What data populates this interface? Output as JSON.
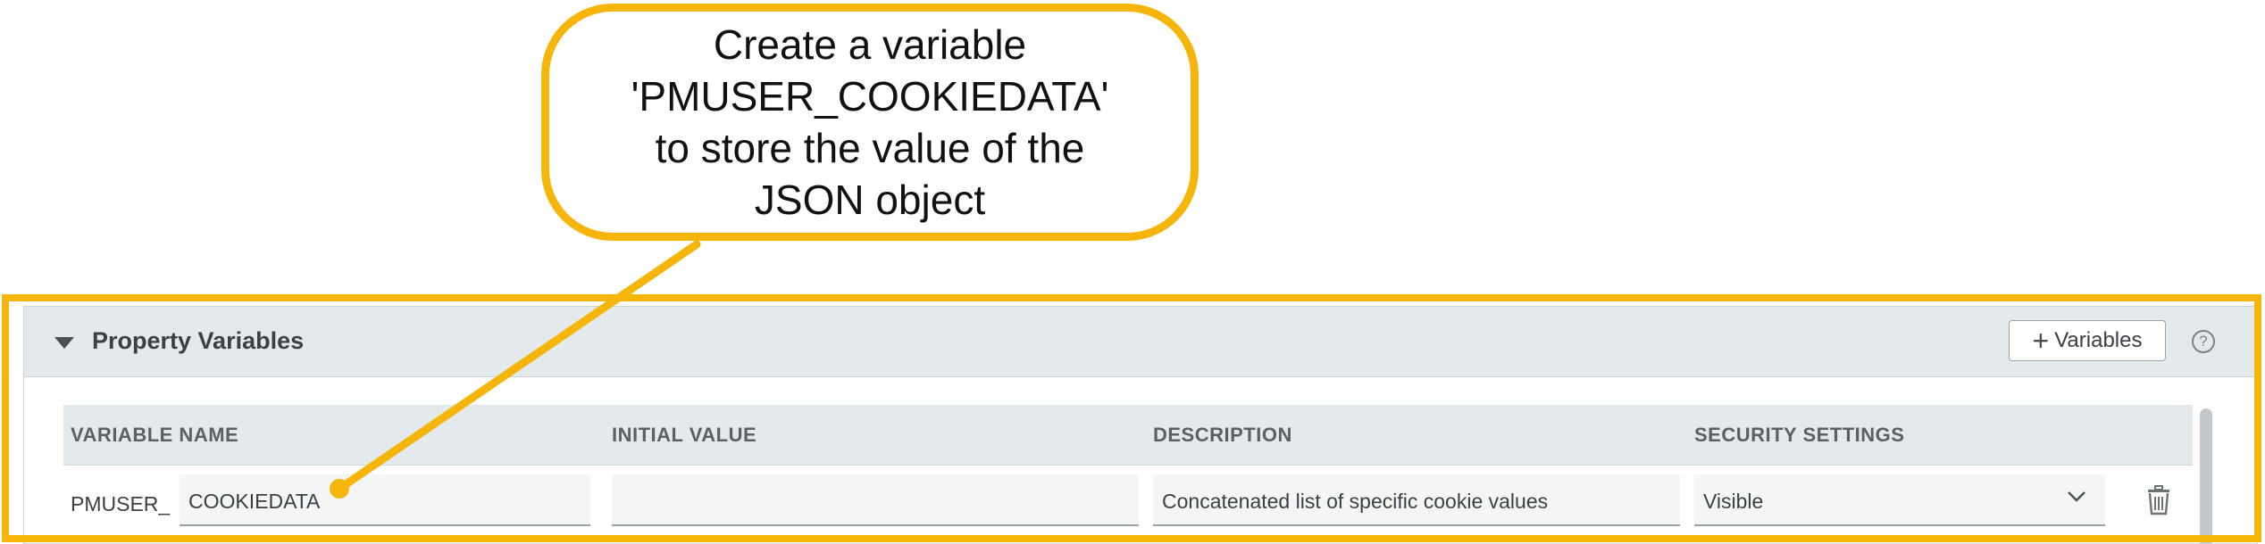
{
  "callout": {
    "text": "Create a variable 'PMUSER_COOKIEDATA' to store the value of the JSON object"
  },
  "panel": {
    "title": "Property Variables",
    "add_button_label": "Variables",
    "add_button_icon": "plus-icon",
    "help_icon": "help-icon",
    "collapse_icon": "caret-down-icon"
  },
  "table": {
    "headers": [
      "VARIABLE NAME",
      "INITIAL VALUE",
      "DESCRIPTION",
      "SECURITY SETTINGS"
    ],
    "rows": [
      {
        "prefix": "PMUSER_",
        "name": "COOKIEDATA",
        "initial_value": "",
        "description": "Concatenated list of specific cookie values",
        "security": "Visible"
      }
    ]
  },
  "colors": {
    "annotation": "#f5b50a",
    "header_bg": "#e4eaeb",
    "field_bg": "#f4f6f6"
  }
}
